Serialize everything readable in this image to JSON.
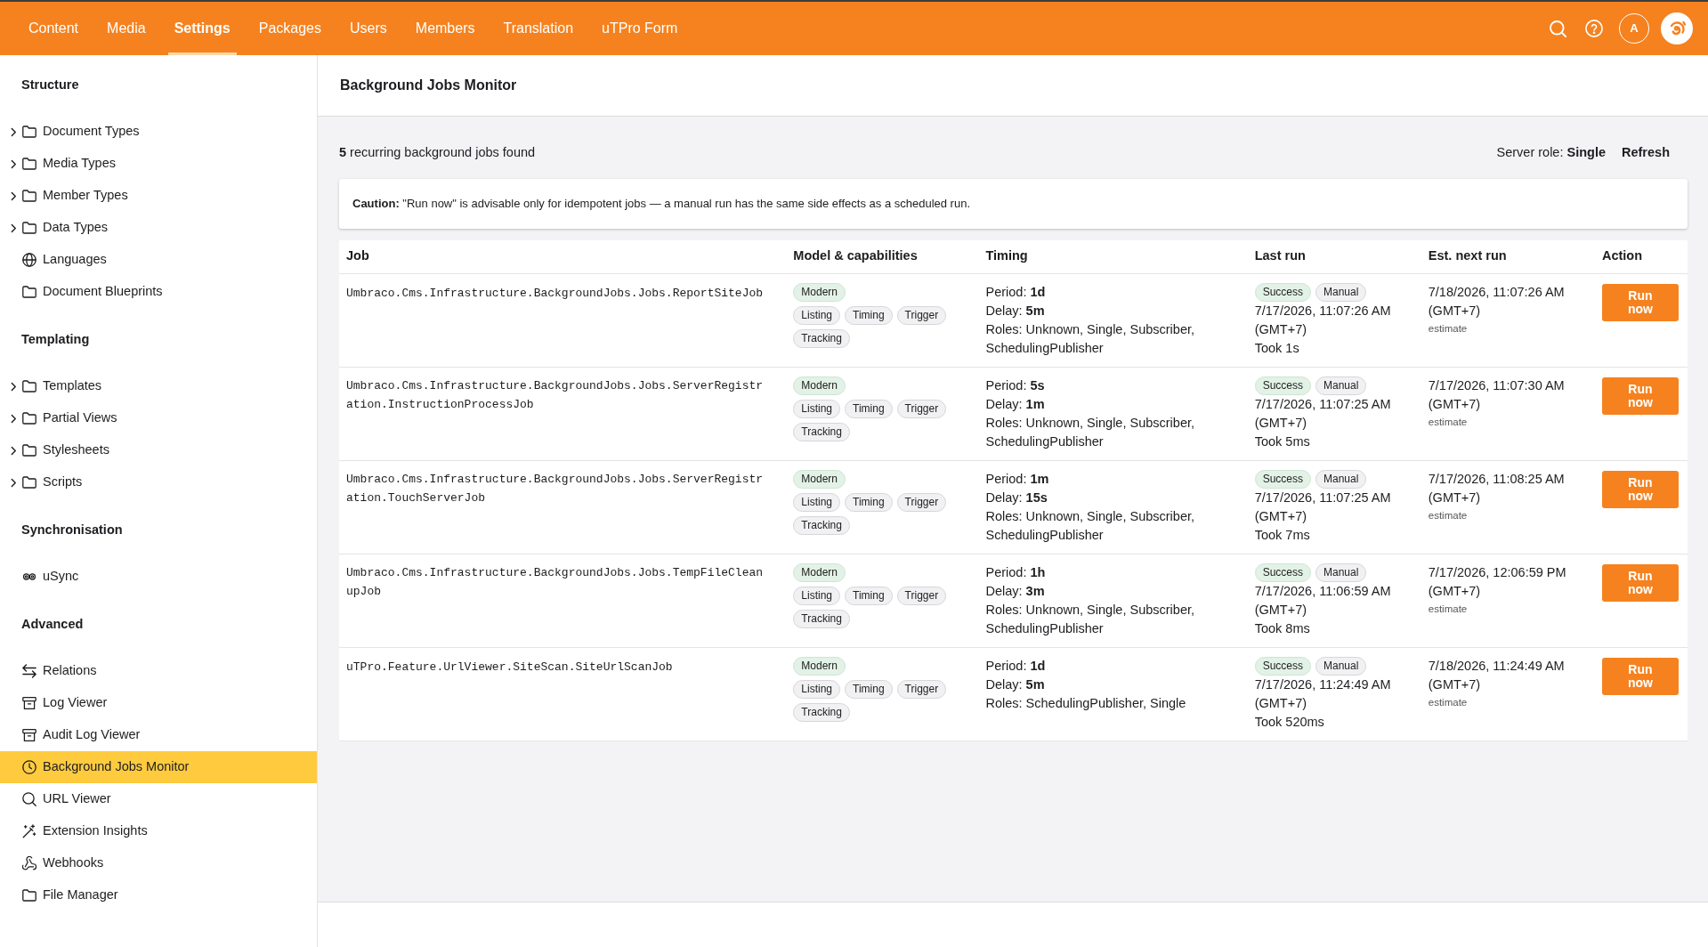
{
  "top_bar": {
    "tabs": [
      {
        "label": "Content",
        "selected": false
      },
      {
        "label": "Media",
        "selected": false
      },
      {
        "label": "Settings",
        "selected": true
      },
      {
        "label": "Packages",
        "selected": false
      },
      {
        "label": "Users",
        "selected": false
      },
      {
        "label": "Members",
        "selected": false
      },
      {
        "label": "Translation",
        "selected": false
      },
      {
        "label": "uTPro Form",
        "selected": false
      }
    ],
    "user_initial": "A"
  },
  "sidebar": {
    "sections": [
      {
        "heading": "Structure",
        "items": [
          {
            "label": "Document Types",
            "expandable": true,
            "selected": false
          },
          {
            "label": "Media Types",
            "expandable": true,
            "selected": false
          },
          {
            "label": "Member Types",
            "expandable": true,
            "selected": false
          },
          {
            "label": "Data Types",
            "expandable": true,
            "selected": false
          },
          {
            "label": "Languages",
            "expandable": false,
            "selected": false
          },
          {
            "label": "Document Blueprints",
            "expandable": false,
            "selected": false
          }
        ]
      },
      {
        "heading": "Templating",
        "items": [
          {
            "label": "Templates",
            "expandable": true,
            "selected": false
          },
          {
            "label": "Partial Views",
            "expandable": true,
            "selected": false
          },
          {
            "label": "Stylesheets",
            "expandable": true,
            "selected": false
          },
          {
            "label": "Scripts",
            "expandable": true,
            "selected": false
          }
        ]
      },
      {
        "heading": "Synchronisation",
        "items": [
          {
            "label": "uSync",
            "expandable": false,
            "selected": false
          }
        ]
      },
      {
        "heading": "Advanced",
        "items": [
          {
            "label": "Relations",
            "expandable": false,
            "selected": false
          },
          {
            "label": "Log Viewer",
            "expandable": false,
            "selected": false
          },
          {
            "label": "Audit Log Viewer",
            "expandable": false,
            "selected": false
          },
          {
            "label": "Background Jobs Monitor",
            "expandable": false,
            "selected": true
          },
          {
            "label": "URL Viewer",
            "expandable": false,
            "selected": false
          },
          {
            "label": "Extension Insights",
            "expandable": false,
            "selected": false
          },
          {
            "label": "Webhooks",
            "expandable": false,
            "selected": false
          },
          {
            "label": "File Manager",
            "expandable": false,
            "selected": false
          }
        ]
      }
    ]
  },
  "page": {
    "title": "Background Jobs Monitor",
    "summary": "**5** recurring background jobs found",
    "server_role": "Server role: **Single**",
    "refresh": "Refresh",
    "caution": "**Caution:** \"Run now\" is advisable only for idempotent jobs — a manual run has the same side effects as a scheduled run."
  },
  "table": {
    "columns": [
      "Job",
      "Model & capabilities",
      "Timing",
      "Last run",
      "Est. next run",
      "Action"
    ],
    "rows": [
      {
        "job": "Umbraco.Cms.Infrastructure.BackgroundJobs.Jobs.ReportSiteJob",
        "model": "Modern",
        "capabilities": [
          "Listing",
          "Timing",
          "Trigger",
          "Tracking"
        ],
        "timing": [
          "Period: **1d**",
          "Delay: **5m**",
          "Roles: Unknown, Single, Subscriber, SchedulingPublisher"
        ],
        "last_run": {
          "status": "Success",
          "trigger": "Manual",
          "time": "7/17/2026, 11:07:26 AM (GMT+7)",
          "duration": "Took 1s"
        },
        "next_run": {
          "time": "7/18/2026, 11:07:26 AM (GMT+7)",
          "note": "estimate"
        },
        "action": "Run now"
      },
      {
        "job": "Umbraco.Cms.Infrastructure.BackgroundJobs.Jobs.ServerRegistration.InstructionProcessJob",
        "model": "Modern",
        "capabilities": [
          "Listing",
          "Timing",
          "Trigger",
          "Tracking"
        ],
        "timing": [
          "Period: **5s**",
          "Delay: **1m**",
          "Roles: Unknown, Single, Subscriber, SchedulingPublisher"
        ],
        "last_run": {
          "status": "Success",
          "trigger": "Manual",
          "time": "7/17/2026, 11:07:25 AM (GMT+7)",
          "duration": "Took 5ms"
        },
        "next_run": {
          "time": "7/17/2026, 11:07:30 AM (GMT+7)",
          "note": "estimate"
        },
        "action": "Run now"
      },
      {
        "job": "Umbraco.Cms.Infrastructure.BackgroundJobs.Jobs.ServerRegistration.TouchServerJob",
        "model": "Modern",
        "capabilities": [
          "Listing",
          "Timing",
          "Trigger",
          "Tracking"
        ],
        "timing": [
          "Period: **1m**",
          "Delay: **15s**",
          "Roles: Unknown, Single, Subscriber, SchedulingPublisher"
        ],
        "last_run": {
          "status": "Success",
          "trigger": "Manual",
          "time": "7/17/2026, 11:07:25 AM (GMT+7)",
          "duration": "Took 7ms"
        },
        "next_run": {
          "time": "7/17/2026, 11:08:25 AM (GMT+7)",
          "note": "estimate"
        },
        "action": "Run now"
      },
      {
        "job": "Umbraco.Cms.Infrastructure.BackgroundJobs.Jobs.TempFileCleanupJob",
        "model": "Modern",
        "capabilities": [
          "Listing",
          "Timing",
          "Trigger",
          "Tracking"
        ],
        "timing": [
          "Period: **1h**",
          "Delay: **3m**",
          "Roles: Unknown, Single, Subscriber, SchedulingPublisher"
        ],
        "last_run": {
          "status": "Success",
          "trigger": "Manual",
          "time": "7/17/2026, 11:06:59 AM (GMT+7)",
          "duration": "Took 8ms"
        },
        "next_run": {
          "time": "7/17/2026, 12:06:59 PM (GMT+7)",
          "note": "estimate"
        },
        "action": "Run now"
      },
      {
        "job": "uTPro.Feature.UrlViewer.SiteScan.SiteUrlScanJob",
        "model": "Modern",
        "capabilities": [
          "Listing",
          "Timing",
          "Trigger",
          "Tracking"
        ],
        "timing": [
          "Period: **1d**",
          "Delay: **5m**",
          "Roles: SchedulingPublisher, Single"
        ],
        "last_run": {
          "status": "Success",
          "trigger": "Manual",
          "time": "7/17/2026, 11:24:49 AM (GMT+7)",
          "duration": "Took 520ms"
        },
        "next_run": {
          "time": "7/18/2026, 11:24:49 AM (GMT+7)",
          "note": "estimate"
        },
        "action": "Run now"
      }
    ]
  }
}
